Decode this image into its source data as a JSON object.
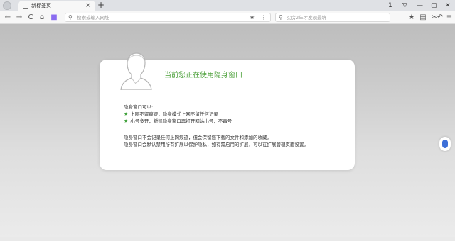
{
  "tab": {
    "title": "新标签页",
    "close_glyph": "×"
  },
  "new_tab_glyph": "+",
  "window_controls": [
    "1",
    "▽",
    "—",
    "▢",
    "✕"
  ],
  "toolbar": {
    "back": "←",
    "forward": "→",
    "reload": "C",
    "home": "⌂",
    "address_placeholder": "搜索或输入网址",
    "address_star": "★",
    "address_menu": "⋮",
    "search_placeholder": "买房2年才发现最坑",
    "right_icons": [
      "★",
      "▤",
      "✂",
      "↶",
      "≡"
    ]
  },
  "card": {
    "title": "当前您正在使用隐身窗口",
    "section_label": "隐身窗口可以:",
    "features": [
      "上网不留痕迹，隐身模式上网不留任何记录",
      "小号多开，新建隐身窗口再打开网站小号，不串号"
    ],
    "notes": [
      "隐身窗口不会记录任何上网痕迹，但会保留您下载的文件和添加的收藏。",
      "隐身窗口会默认禁用所有扩展以保护隐私，如有需启用的扩展，可以在扩展管理页面设置。"
    ]
  },
  "icons": {
    "browser_logo": "browser-logo-icon",
    "tab_favicon": "page-icon",
    "avatar": "incognito-user-icon",
    "side_badge": "sidebar-toggle-icon"
  },
  "colors": {
    "title_green": "#4ca03a",
    "star_green": "#43a33e",
    "badge_blue": "#3d6fd8"
  }
}
